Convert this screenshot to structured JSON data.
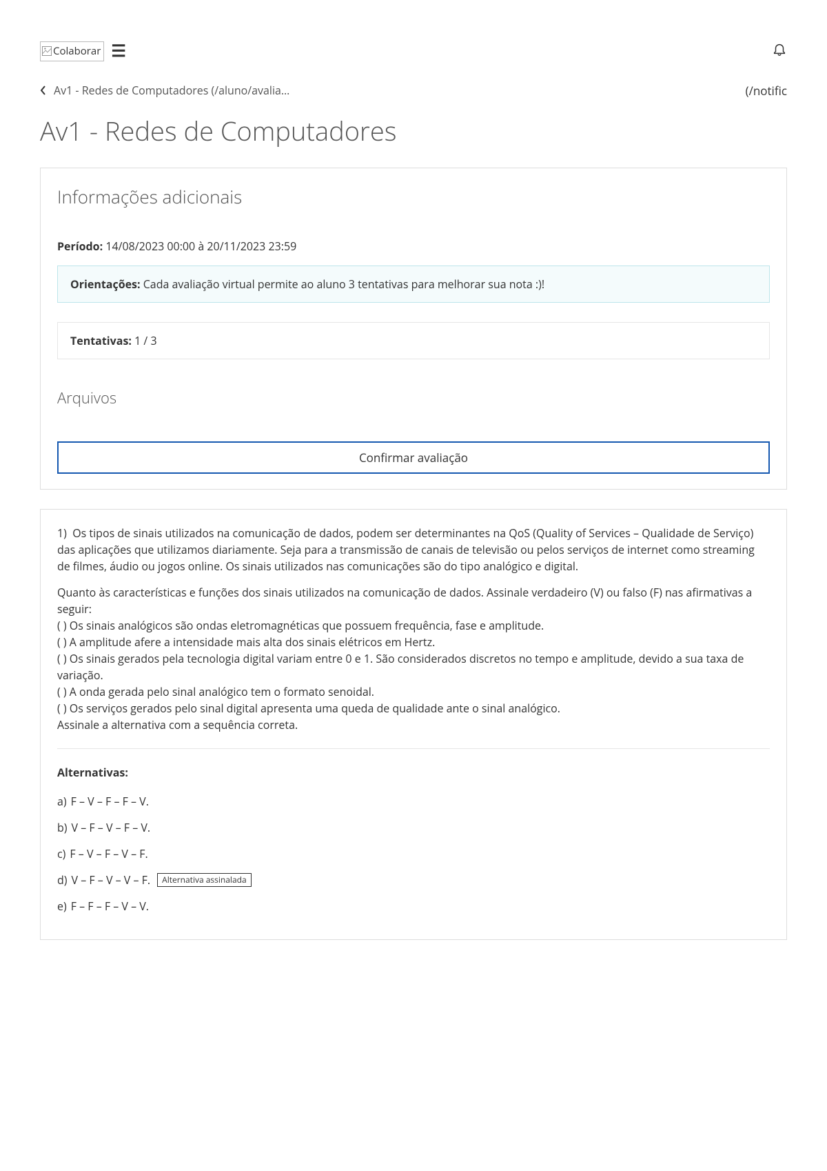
{
  "brand": {
    "label": "Colaborar"
  },
  "breadcrumb": {
    "text": "Av1 - Redes de Computadores (/aluno/avalia…"
  },
  "right_link": {
    "text": "(/notific"
  },
  "page_title": "Av1 - Redes de Computadores",
  "info_section": {
    "heading": "Informações adicionais",
    "periodo_label": "Período:",
    "periodo_value": " 14/08/2023 00:00 à 20/11/2023 23:59",
    "orient_label": "Orientações:",
    "orient_value": " Cada avaliação virtual permite ao aluno 3 tentativas para melhorar sua nota :)!",
    "tent_label": "Tentativas:",
    "tent_value": " 1 / 3",
    "arquivos_heading": "Arquivos",
    "confirm_label": "Confirmar avaliação"
  },
  "question": {
    "number": "1)",
    "para1": "Os tipos de sinais utilizados na comunicação de dados, podem ser determinantes na QoS (Quality of Services – Qualidade de Serviço) das aplicações que utilizamos diariamente. Seja para a transmissão de canais de televisão ou pelos serviços de internet como streaming de filmes, áudio ou jogos online. Os sinais utilizados nas comunicações são do tipo analógico e digital.",
    "para2": "Quanto às características e funções dos sinais utilizados na comunicação de dados. Assinale verdadeiro (V) ou falso (F) nas afirmativas a seguir:",
    "stmt1": "( ) Os sinais analógicos são ondas eletromagnéticas que possuem frequência, fase e amplitude.",
    "stmt2": "( ) A amplitude afere a intensidade mais alta dos sinais elétricos em Hertz.",
    "stmt3": "( ) Os sinais gerados pela tecnologia digital variam entre 0 e 1. São considerados discretos no tempo e amplitude, devido a sua taxa de variação.",
    "stmt4": "( ) A onda gerada pelo sinal analógico tem o formato senoidal.",
    "stmt5": "( ) Os serviços gerados pelo sinal digital apresenta uma queda de qualidade ante o sinal analógico.",
    "closing": "Assinale a alternativa com a sequência correta.",
    "alt_heading": "Alternativas:",
    "alts": [
      {
        "key": "a)",
        "text": "F – V – F – F – V.",
        "selected": false
      },
      {
        "key": "b)",
        "text": "V – F – V – F – V.",
        "selected": false
      },
      {
        "key": "c)",
        "text": "F – V – F – V – F.",
        "selected": false
      },
      {
        "key": "d)",
        "text": "V – F – V – V – F.",
        "selected": true
      },
      {
        "key": "e)",
        "text": "F – F – F – V – V.",
        "selected": false
      }
    ],
    "selected_badge": "Alternativa assinalada"
  }
}
